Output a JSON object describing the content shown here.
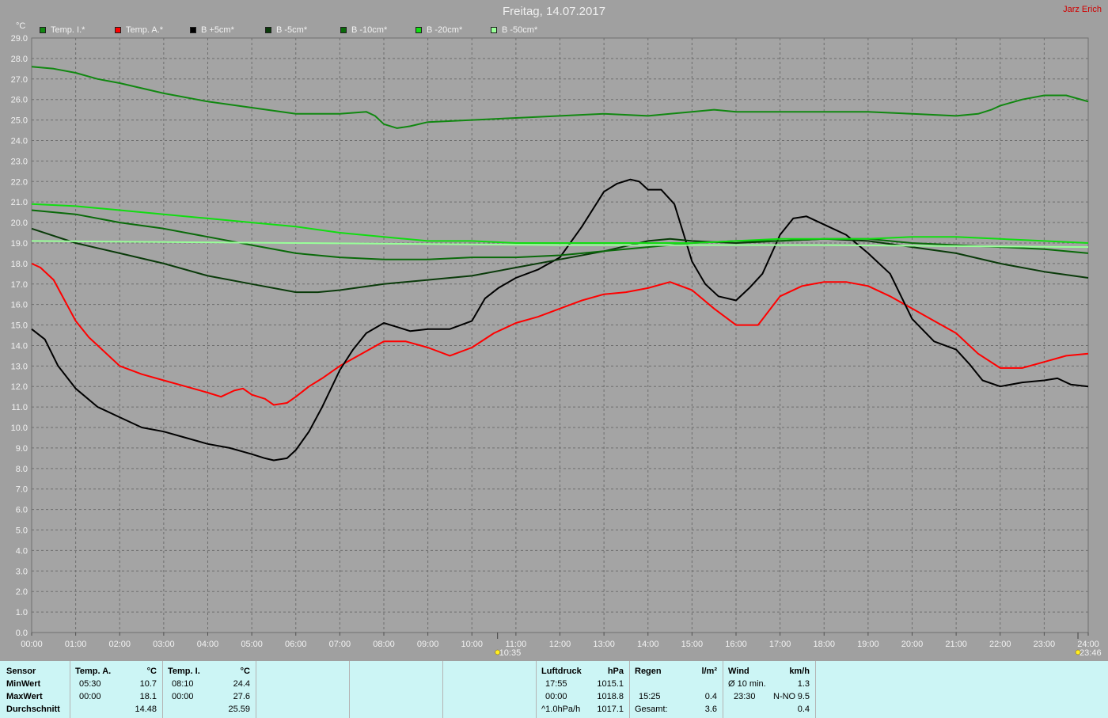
{
  "title": "Freitag, 14.07.2017",
  "author": "Jarz Erich",
  "unit": "°C",
  "legend": [
    {
      "label": "Temp. I.*",
      "color": "#118811"
    },
    {
      "label": "Temp. A.*",
      "color": "#ff0000"
    },
    {
      "label": "B +5cm*",
      "color": "#000000"
    },
    {
      "label": "B -5cm*",
      "color": "#0a3a0a"
    },
    {
      "label": "B -10cm*",
      "color": "#0a6a0a"
    },
    {
      "label": "B -20cm*",
      "color": "#11dd11"
    },
    {
      "label": "B -50cm*",
      "color": "#99ff99"
    }
  ],
  "chart_data": {
    "type": "line",
    "title": "Freitag, 14.07.2017",
    "ylabel": "°C",
    "ylim": [
      0,
      29
    ],
    "xlim": [
      0,
      24
    ],
    "grid": true,
    "legend_position": "top",
    "y_ticks": [
      "0.0",
      "1.0",
      "2.0",
      "3.0",
      "4.0",
      "5.0",
      "6.0",
      "7.0",
      "8.0",
      "9.0",
      "10.0",
      "11.0",
      "12.0",
      "13.0",
      "14.0",
      "15.0",
      "16.0",
      "17.0",
      "18.0",
      "19.0",
      "20.0",
      "21.0",
      "22.0",
      "23.0",
      "24.0",
      "25.0",
      "26.0",
      "27.0",
      "28.0",
      "29.0"
    ],
    "x_ticks": [
      "00:00",
      "01:00",
      "02:00",
      "03:00",
      "04:00",
      "05:00",
      "06:00",
      "07:00",
      "08:00",
      "09:00",
      "10:00",
      "11:00",
      "12:00",
      "13:00",
      "14:00",
      "15:00",
      "16:00",
      "17:00",
      "18:00",
      "19:00",
      "20:00",
      "21:00",
      "22:00",
      "23:00",
      "24:00"
    ],
    "markers": [
      {
        "time": "10:35",
        "x": 10.583
      },
      {
        "time": "23:46",
        "x": 23.767
      }
    ],
    "series": [
      {
        "name": "Temp. I.*",
        "color": "#118811",
        "x": [
          0,
          0.5,
          1,
          1.5,
          2,
          3,
          4,
          5,
          6,
          7,
          7.6,
          7.8,
          8,
          8.3,
          8.6,
          9,
          10,
          11,
          12,
          13,
          14,
          14.5,
          15,
          15.5,
          16,
          17,
          18,
          19,
          20,
          21,
          21.5,
          21.8,
          22,
          22.5,
          23,
          23.5,
          24
        ],
        "y": [
          27.6,
          27.5,
          27.3,
          27.0,
          26.8,
          26.3,
          25.9,
          25.6,
          25.3,
          25.3,
          25.4,
          25.2,
          24.8,
          24.6,
          24.7,
          24.9,
          25.0,
          25.1,
          25.2,
          25.3,
          25.2,
          25.3,
          25.4,
          25.5,
          25.4,
          25.4,
          25.4,
          25.4,
          25.3,
          25.2,
          25.3,
          25.5,
          25.7,
          26.0,
          26.2,
          26.2,
          25.9
        ]
      },
      {
        "name": "Temp. A.*",
        "color": "#ff0000",
        "x": [
          0,
          0.2,
          0.5,
          0.8,
          1,
          1.3,
          1.6,
          2,
          2.5,
          3,
          3.5,
          4,
          4.3,
          4.6,
          4.8,
          5,
          5.3,
          5.5,
          5.8,
          6,
          6.3,
          6.6,
          7,
          7.5,
          8,
          8.5,
          9,
          9.5,
          10,
          10.5,
          11,
          11.5,
          12,
          12.5,
          13,
          13.5,
          14,
          14.5,
          15,
          15.5,
          16,
          16.5,
          17,
          17.5,
          18,
          18.5,
          19,
          19.5,
          20,
          20.5,
          21,
          21.5,
          22,
          22.5,
          23,
          23.5,
          24
        ],
        "y": [
          18.0,
          17.8,
          17.2,
          16.0,
          15.2,
          14.4,
          13.8,
          13.0,
          12.6,
          12.3,
          12.0,
          11.7,
          11.5,
          11.8,
          11.9,
          11.6,
          11.4,
          11.1,
          11.2,
          11.5,
          12.0,
          12.4,
          13.0,
          13.6,
          14.2,
          14.2,
          13.9,
          13.5,
          13.9,
          14.6,
          15.1,
          15.4,
          15.8,
          16.2,
          16.5,
          16.6,
          16.8,
          17.1,
          16.7,
          15.8,
          15.0,
          15.0,
          16.4,
          16.9,
          17.1,
          17.1,
          16.9,
          16.4,
          15.8,
          15.2,
          14.6,
          13.6,
          12.9,
          12.9,
          13.2,
          13.5,
          13.6
        ]
      },
      {
        "name": "B +5cm*",
        "color": "#000000",
        "x": [
          0,
          0.3,
          0.6,
          1,
          1.5,
          2,
          2.5,
          3,
          3.5,
          4,
          4.5,
          5,
          5.3,
          5.5,
          5.8,
          6,
          6.3,
          6.6,
          7,
          7.3,
          7.6,
          8,
          8.3,
          8.6,
          9,
          9.5,
          10,
          10.3,
          10.6,
          11,
          11.5,
          12,
          12.5,
          13,
          13.3,
          13.6,
          13.8,
          14,
          14.3,
          14.6,
          14.8,
          15,
          15.3,
          15.6,
          16,
          16.3,
          16.6,
          17,
          17.3,
          17.6,
          18,
          18.5,
          19,
          19.5,
          20,
          20.5,
          21,
          21.3,
          21.6,
          22,
          22.5,
          23,
          23.3,
          23.6,
          24
        ],
        "y": [
          14.8,
          14.3,
          13.0,
          11.9,
          11.0,
          10.5,
          10.0,
          9.8,
          9.5,
          9.2,
          9.0,
          8.7,
          8.5,
          8.4,
          8.5,
          8.9,
          9.8,
          11.0,
          12.8,
          13.8,
          14.6,
          15.1,
          14.9,
          14.7,
          14.8,
          14.8,
          15.2,
          16.3,
          16.8,
          17.3,
          17.7,
          18.3,
          19.8,
          21.5,
          21.9,
          22.1,
          22.0,
          21.6,
          21.6,
          20.9,
          19.5,
          18.1,
          17.0,
          16.4,
          16.2,
          16.8,
          17.5,
          19.4,
          20.2,
          20.3,
          19.9,
          19.4,
          18.5,
          17.5,
          15.3,
          14.2,
          13.8,
          13.1,
          12.3,
          12.0,
          12.2,
          12.3,
          12.4,
          12.1,
          12.0
        ]
      },
      {
        "name": "B -5cm*",
        "color": "#0a3a0a",
        "x": [
          0,
          1,
          2,
          3,
          4,
          5,
          6,
          6.5,
          7,
          8,
          9,
          10,
          11,
          12,
          13,
          14,
          14.5,
          15,
          16,
          17,
          18,
          19,
          20,
          21,
          22,
          23,
          24
        ],
        "y": [
          19.7,
          19.0,
          18.5,
          18.0,
          17.4,
          17.0,
          16.6,
          16.6,
          16.7,
          17.0,
          17.2,
          17.4,
          17.8,
          18.2,
          18.6,
          19.1,
          19.2,
          19.1,
          19.0,
          19.1,
          19.2,
          19.1,
          18.8,
          18.5,
          18.0,
          17.6,
          17.3
        ]
      },
      {
        "name": "B -10cm*",
        "color": "#0a6a0a",
        "x": [
          0,
          1,
          2,
          3,
          4,
          5,
          6,
          7,
          8,
          9,
          10,
          11,
          12,
          13,
          14,
          15,
          16,
          17,
          18,
          19,
          20,
          21,
          22,
          23,
          24
        ],
        "y": [
          20.6,
          20.4,
          20.0,
          19.7,
          19.3,
          18.9,
          18.5,
          18.3,
          18.2,
          18.2,
          18.3,
          18.3,
          18.4,
          18.6,
          18.8,
          19.0,
          19.1,
          19.1,
          19.2,
          19.2,
          19.0,
          18.9,
          18.8,
          18.7,
          18.5
        ]
      },
      {
        "name": "B -20cm*",
        "color": "#11dd11",
        "x": [
          0,
          1,
          2,
          3,
          4,
          5,
          6,
          7,
          8,
          9,
          10,
          11,
          12,
          13,
          14,
          15,
          16,
          17,
          18,
          19,
          20,
          21,
          22,
          23,
          24
        ],
        "y": [
          20.9,
          20.8,
          20.6,
          20.4,
          20.2,
          20.0,
          19.8,
          19.5,
          19.3,
          19.1,
          19.1,
          19.0,
          19.0,
          19.0,
          19.0,
          19.0,
          19.1,
          19.2,
          19.2,
          19.2,
          19.3,
          19.3,
          19.2,
          19.1,
          19.0
        ]
      },
      {
        "name": "B -50cm*",
        "color": "#99ff99",
        "x": [
          0,
          6,
          12,
          18,
          24
        ],
        "y": [
          19.1,
          19.0,
          18.9,
          18.9,
          18.8
        ]
      }
    ]
  },
  "stats": {
    "labels": {
      "sensor": "Sensor",
      "min": "MinWert",
      "max": "MaxWert",
      "avg": "Durchschnitt"
    },
    "temp_a": {
      "header": "Temp. A.",
      "unit": "°C",
      "min_time": "05:30",
      "min_val": "10.7",
      "max_time": "00:00",
      "max_val": "18.1",
      "avg": "14.48"
    },
    "temp_i": {
      "header": "Temp. I.",
      "unit": "°C",
      "min_time": "08:10",
      "min_val": "24.4",
      "max_time": "00:00",
      "max_val": "27.6",
      "avg": "25.59"
    },
    "luftdruck": {
      "header": "Luftdruck",
      "unit": "hPa",
      "min_time": "17:55",
      "min_val": "1015.1",
      "max_time": "00:00",
      "max_val": "1018.8",
      "trend": "^1.0hPa/h",
      "current": "1017.1"
    },
    "regen": {
      "header": "Regen",
      "unit": "l/m²",
      "time": "15:25",
      "val": "0.4",
      "total_label": "Gesamt:",
      "total": "3.6"
    },
    "wind": {
      "header": "Wind",
      "unit": "km/h",
      "avg_label": "Ø 10 min.",
      "avg_val": "1.3",
      "max_time": "23:30",
      "max_dir": "N-NO",
      "max_val": "9.5",
      "day_avg": "0.4"
    }
  }
}
